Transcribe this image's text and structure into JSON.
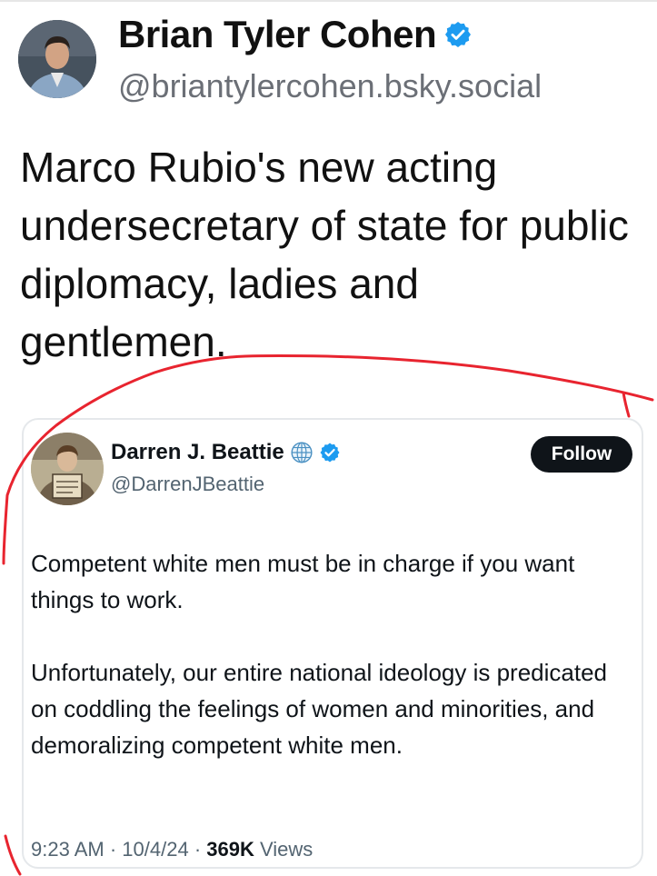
{
  "post": {
    "author_name": "Brian Tyler Cohen",
    "author_handle": "@briantylercohen.bsky.social",
    "text": "Marco Rubio's new acting undersecretary of state for public diplomacy, ladies and gentlemen."
  },
  "embed": {
    "author_name": "Darren J. Beattie",
    "author_handle": "@DarrenJBeattie",
    "follow_label": "Follow",
    "paragraphs": [
      "Competent white men must be in charge if you want things to work.",
      "Unfortunately, our entire national ideology is predicated on coddling the feelings of women and minorities, and demoralizing competent white men."
    ],
    "time": "9:23 AM",
    "date": "10/4/24",
    "views_count": "369K",
    "views_label": "Views",
    "separator": "·"
  },
  "icons": {
    "verified": "verified-badge-icon",
    "globe": "globe-icon"
  },
  "colors": {
    "verified_blue": "#1d9bf0",
    "annotation_red": "#e8242f",
    "follow_bg": "#0f1419"
  }
}
